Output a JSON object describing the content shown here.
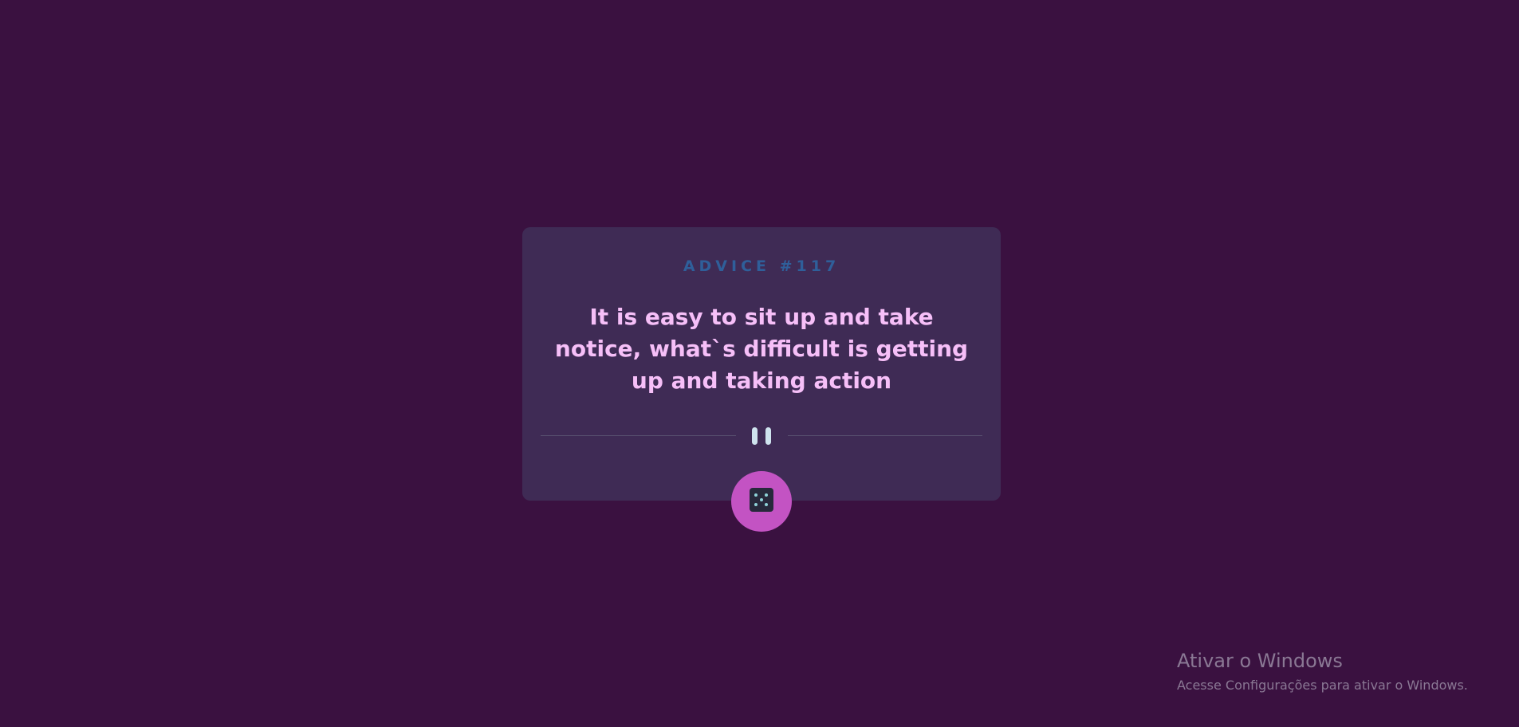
{
  "card": {
    "label": "ADVICE #117",
    "advice": "It is easy to sit up and take notice, what`s difficult is getting up and taking action"
  },
  "divider": {
    "icon": "pause-icon"
  },
  "dice_button": {
    "icon": "dice-icon"
  },
  "watermark": {
    "title": "Ativar o Windows",
    "subtitle": "Acesse Configurações para ativar o Windows."
  },
  "colors": {
    "background": "#3a1140",
    "card": "#3f2b55",
    "label": "#2f5f9a",
    "advice_text": "#f6bff8",
    "button": "#c353c3",
    "pause": "#cfe3ee"
  }
}
